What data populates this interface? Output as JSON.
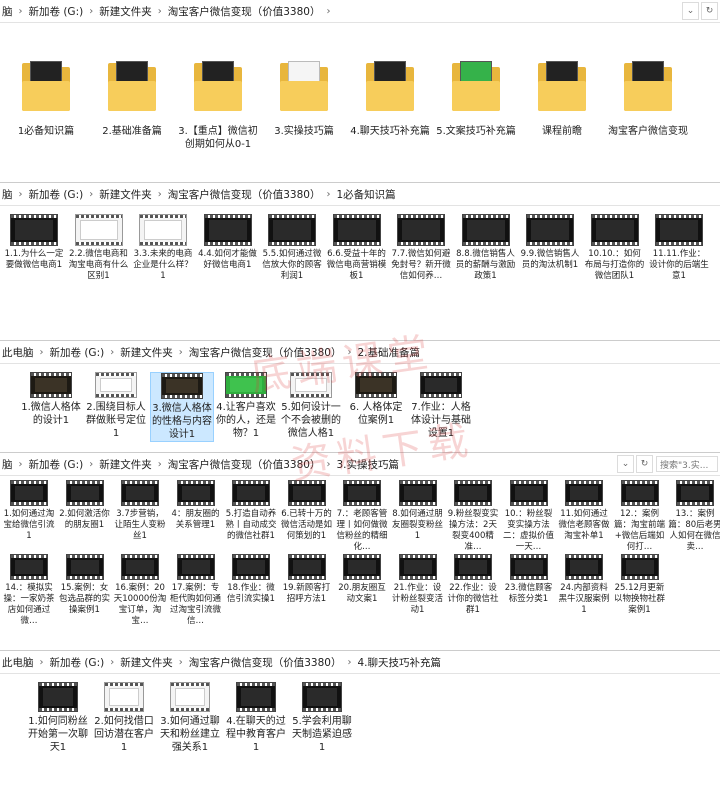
{
  "windows": [
    {
      "path": [
        "新加卷 (G:)",
        "新建文件夹",
        "淘宝客户微信变现（价值3380）"
      ],
      "lead": "脑",
      "items": [
        {
          "label": "1必备知识篇",
          "kind": "folder",
          "paper": "dark"
        },
        {
          "label": "2.基础准备篇",
          "kind": "folder",
          "paper": "dark"
        },
        {
          "label": "3.【重点】微信初创期如何从0-1",
          "kind": "folder",
          "paper": "dark"
        },
        {
          "label": "3.实操技巧篇",
          "kind": "folder",
          "paper": "light"
        },
        {
          "label": "4.聊天技巧补充篇",
          "kind": "folder",
          "paper": "dark"
        },
        {
          "label": "5.文案技巧补充篇",
          "kind": "folder",
          "paper": "green"
        },
        {
          "label": "课程前瞻",
          "kind": "folder",
          "paper": "dark"
        },
        {
          "label": "淘宝客户微信变现",
          "kind": "folder",
          "paper": "dark"
        }
      ]
    },
    {
      "path": [
        "新加卷 (G:)",
        "新建文件夹",
        "淘宝客户微信变现（价值3380）",
        "1必备知识篇"
      ],
      "lead": "脑",
      "items": [
        {
          "label": "1.1.为什么一定要做微信电商1",
          "style": "dark"
        },
        {
          "label": "2.2.微信电商和淘宝电商有什么区别1",
          "style": "light"
        },
        {
          "label": "3.3.未来的电商企业是什么样？1",
          "style": "light"
        },
        {
          "label": "4.4.如何才能做好微信电商1",
          "style": "dark"
        },
        {
          "label": "5.5.如何通过微信放大你的顾客利润1",
          "style": "dark"
        },
        {
          "label": "6.6.受益十年的微信电商营销模板1",
          "style": "dark"
        },
        {
          "label": "7.7.微信如何避免封号？新开微信如何养…",
          "style": "dark"
        },
        {
          "label": "8.8.微信销售人员的薪酬与激励政策1",
          "style": "dark"
        },
        {
          "label": "9.9.微信销售人员的淘汰机制1",
          "style": "dark"
        },
        {
          "label": "10.10.：如何布局与打造你的微信团队1",
          "style": "dark"
        },
        {
          "label": "11.11.作业：设计你的后端生意1",
          "style": "dark"
        }
      ]
    },
    {
      "path": [
        "新加卷 (G:)",
        "新建文件夹",
        "淘宝客户微信变现（价值3380）",
        "2.基础准备篇"
      ],
      "lead": "此电脑",
      "items": [
        {
          "label": "1.微信人格体的设计1",
          "style": "gold"
        },
        {
          "label": "2.围绕目标人群做账号定位1",
          "style": "light"
        },
        {
          "label": "3.微信人格体的性格与内容设计1",
          "style": "gold"
        },
        {
          "label": "4.让客户喜欢你的人，还是物？1",
          "style": "green"
        },
        {
          "label": "5.如何设计一个不会被删的微信人格1",
          "style": "light"
        },
        {
          "label": "6. 人格体定位案例1",
          "style": "gold"
        },
        {
          "label": "7.作业：人格体设计与基础设置1",
          "style": "dark"
        }
      ]
    },
    {
      "path": [
        "新加卷 (G:)",
        "新建文件夹",
        "淘宝客户微信变现（价值3380）",
        "3.实操技巧篇"
      ],
      "lead": "脑",
      "search": "搜索\"3.实...",
      "items": [
        {
          "label": "1.如何通过淘宝给微信引流1"
        },
        {
          "label": "2.如何激活你的朋友圈1"
        },
        {
          "label": "3.7步营销，让陌生人变粉丝1"
        },
        {
          "label": "4：朋友圈的关系管理1"
        },
        {
          "label": "5.打造自动养熟丨自动成交的微信社群1"
        },
        {
          "label": "6.已转十万的微信活动是如何策划的1"
        },
        {
          "label": "7.：老顾客管理丨如何做微信粉丝的精细化…"
        },
        {
          "label": "8.如何通过朋友圈裂变粉丝1"
        },
        {
          "label": "9.粉丝裂变实操方法：2天裂变400精准…"
        },
        {
          "label": "10.：粉丝裂变实操方法二：虚拟价值一天…"
        },
        {
          "label": "11.如何通过微信老顾客做淘宝补单1"
        },
        {
          "label": "12.：案例篇：淘宝前端+微信后端如何打…"
        },
        {
          "label": "13.：案例篇：80后老男人如何在微信卖…"
        },
        {
          "label": "14.：模拟实操：一家奶茶店如何通过微…"
        },
        {
          "label": "15.案例：女包选品群的实操案例1"
        },
        {
          "label": "16.案例：20天10000份淘宝订单，淘宝…"
        },
        {
          "label": "17.案例：专柜代购如何通过淘宝引流微信…"
        },
        {
          "label": "18.作业：微信引流实操1"
        },
        {
          "label": "19.新顾客打招呼方法1"
        },
        {
          "label": "20.朋友圈互动文案1"
        },
        {
          "label": "21.作业：设计粉丝裂变活动1"
        },
        {
          "label": "22.作业：设计你的微信社群1"
        },
        {
          "label": "23.微信顾客标签分类1"
        },
        {
          "label": "24.内部资料黑牛汉服案例1"
        },
        {
          "label": "25.12月更新以物换物社群案例1"
        }
      ]
    },
    {
      "path": [
        "新加卷 (G:)",
        "新建文件夹",
        "淘宝客户微信变现（价值3380）",
        "4.聊天技巧补充篇"
      ],
      "lead": "此电脑",
      "items": [
        {
          "label": "1.如何同粉丝开始第一次聊天1",
          "style": "dark"
        },
        {
          "label": "2.如何找借口回访潜在客户1",
          "style": "light"
        },
        {
          "label": "3.如何通过聊天和粉丝建立强关系1",
          "style": "light"
        },
        {
          "label": "4.在聊天的过程中教育客户1",
          "style": "dark"
        },
        {
          "label": "5.学会利用聊天制造紧迫感1",
          "style": "dark"
        }
      ]
    }
  ],
  "watermark": [
    "底端课堂",
    "资料下载"
  ]
}
